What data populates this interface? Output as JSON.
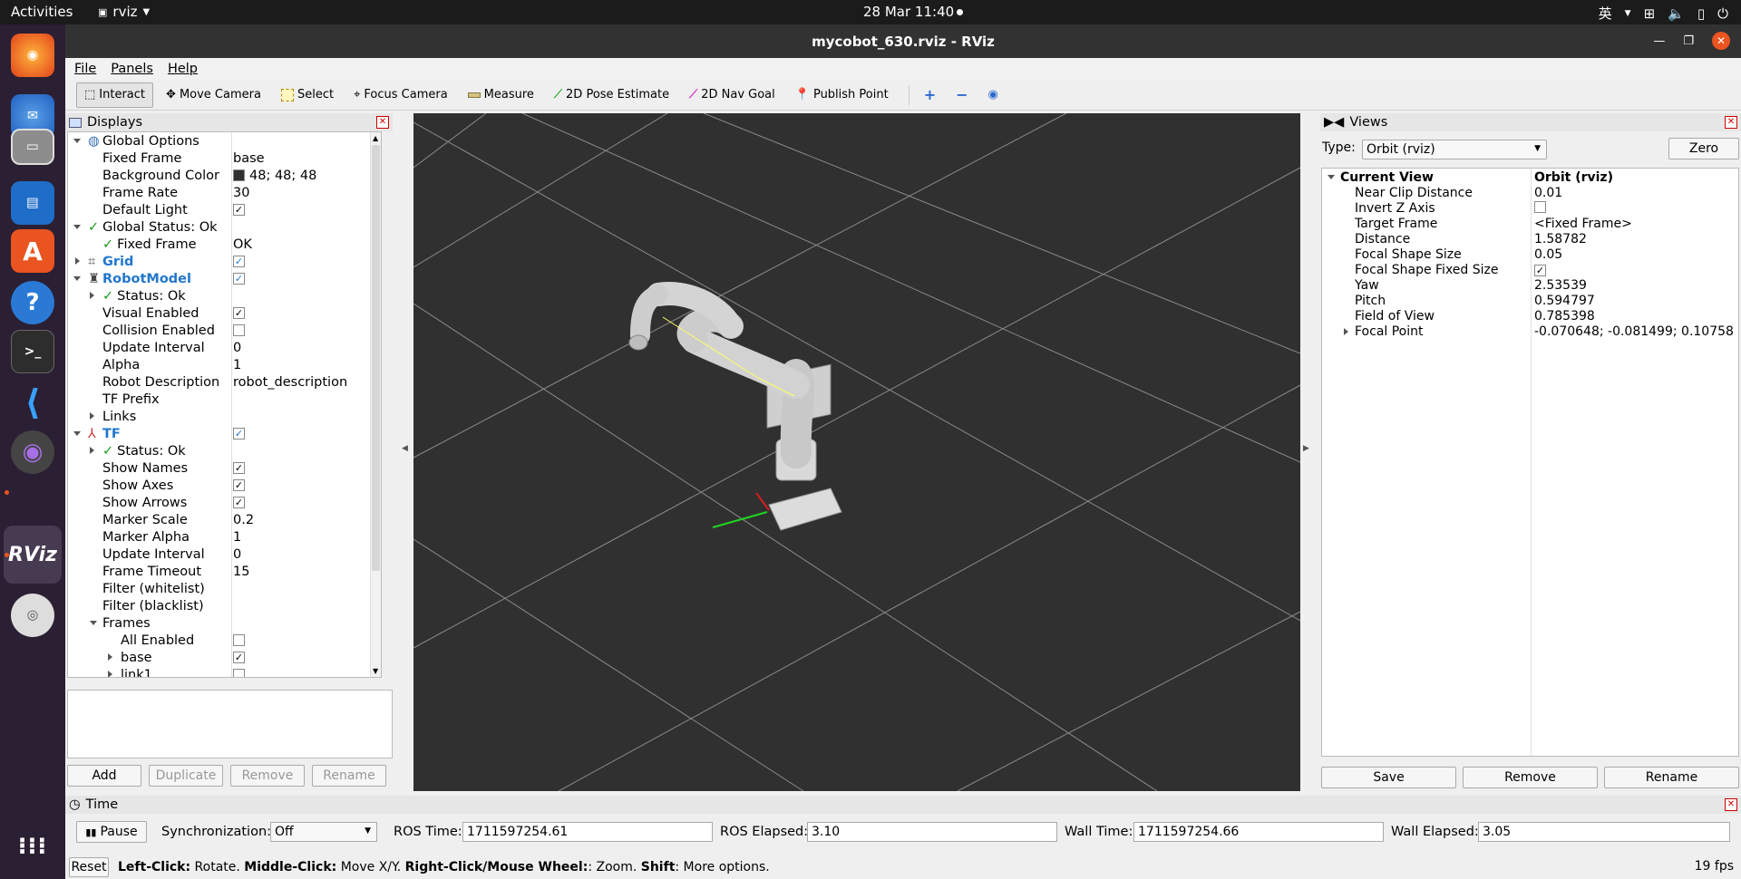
{
  "topbar": {
    "activities": "Activities",
    "app_name": "rviz",
    "clock": "28 Mar  11:40",
    "lang": "英"
  },
  "window": {
    "title": "mycobot_630.rviz - RViz"
  },
  "menu": {
    "file": "File",
    "panels": "Panels",
    "help": "Help"
  },
  "toolbar": {
    "interact": "Interact",
    "move_camera": "Move Camera",
    "select": "Select",
    "focus_camera": "Focus Camera",
    "measure": "Measure",
    "pose_estimate": "2D Pose Estimate",
    "nav_goal": "2D Nav Goal",
    "publish_point": "Publish Point"
  },
  "displays": {
    "title": "Displays",
    "rows": [
      {
        "label": "Global Options",
        "value": ""
      },
      {
        "label": "Fixed Frame",
        "value": "base"
      },
      {
        "label": "Background Color",
        "value": "48; 48; 48"
      },
      {
        "label": "Frame Rate",
        "value": "30"
      },
      {
        "label": "Default Light",
        "value": ""
      },
      {
        "label": "Global Status: Ok",
        "value": ""
      },
      {
        "label": "Fixed Frame",
        "value": "OK"
      },
      {
        "label": "Grid",
        "value": ""
      },
      {
        "label": "RobotModel",
        "value": ""
      },
      {
        "label": "Status: Ok",
        "value": ""
      },
      {
        "label": "Visual Enabled",
        "value": ""
      },
      {
        "label": "Collision Enabled",
        "value": ""
      },
      {
        "label": "Update Interval",
        "value": "0"
      },
      {
        "label": "Alpha",
        "value": "1"
      },
      {
        "label": "Robot Description",
        "value": "robot_description"
      },
      {
        "label": "TF Prefix",
        "value": ""
      },
      {
        "label": "Links",
        "value": ""
      },
      {
        "label": "TF",
        "value": ""
      },
      {
        "label": "Status: Ok",
        "value": ""
      },
      {
        "label": "Show Names",
        "value": ""
      },
      {
        "label": "Show Axes",
        "value": ""
      },
      {
        "label": "Show Arrows",
        "value": ""
      },
      {
        "label": "Marker Scale",
        "value": "0.2"
      },
      {
        "label": "Marker Alpha",
        "value": "1"
      },
      {
        "label": "Update Interval",
        "value": "0"
      },
      {
        "label": "Frame Timeout",
        "value": "15"
      },
      {
        "label": "Filter (whitelist)",
        "value": ""
      },
      {
        "label": "Filter (blacklist)",
        "value": ""
      },
      {
        "label": "Frames",
        "value": ""
      },
      {
        "label": "All Enabled",
        "value": ""
      },
      {
        "label": "base",
        "value": ""
      },
      {
        "label": "link1",
        "value": ""
      }
    ],
    "buttons": {
      "add": "Add",
      "duplicate": "Duplicate",
      "remove": "Remove",
      "rename": "Rename"
    },
    "bg_color": "#303030"
  },
  "views": {
    "title": "Views",
    "type_label": "Type:",
    "type_value": "Orbit (rviz)",
    "zero": "Zero",
    "header_label": "Current View",
    "header_value": "Orbit (rviz)",
    "props": [
      {
        "label": "Near Clip Distance",
        "value": "0.01"
      },
      {
        "label": "Invert Z Axis",
        "value": ""
      },
      {
        "label": "Target Frame",
        "value": "<Fixed Frame>"
      },
      {
        "label": "Distance",
        "value": "1.58782"
      },
      {
        "label": "Focal Shape Size",
        "value": "0.05"
      },
      {
        "label": "Focal Shape Fixed Size",
        "value": ""
      },
      {
        "label": "Yaw",
        "value": "2.53539"
      },
      {
        "label": "Pitch",
        "value": "0.594797"
      },
      {
        "label": "Field of View",
        "value": "0.785398"
      },
      {
        "label": "Focal Point",
        "value": "-0.070648; -0.081499; 0.10758"
      }
    ],
    "buttons": {
      "save": "Save",
      "remove": "Remove",
      "rename": "Rename"
    }
  },
  "time": {
    "title": "Time",
    "pause": "Pause",
    "sync_label": "Synchronization:",
    "sync_value": "Off",
    "ros_time_label": "ROS Time:",
    "ros_time": "1711597254.61",
    "ros_elapsed_label": "ROS Elapsed:",
    "ros_elapsed": "3.10",
    "wall_time_label": "Wall Time:",
    "wall_time": "1711597254.66",
    "wall_elapsed_label": "Wall Elapsed:",
    "wall_elapsed": "3.05"
  },
  "status": {
    "reset": "Reset",
    "left_b": "Left-Click:",
    "left_t": " Rotate. ",
    "mid_b": "Middle-Click:",
    "mid_t": " Move X/Y. ",
    "right_b": "Right-Click/Mouse Wheel:",
    "right_t": ": Zoom. ",
    "shift_b": "Shift",
    "shift_t": ": More options.",
    "fps": "19 fps"
  }
}
